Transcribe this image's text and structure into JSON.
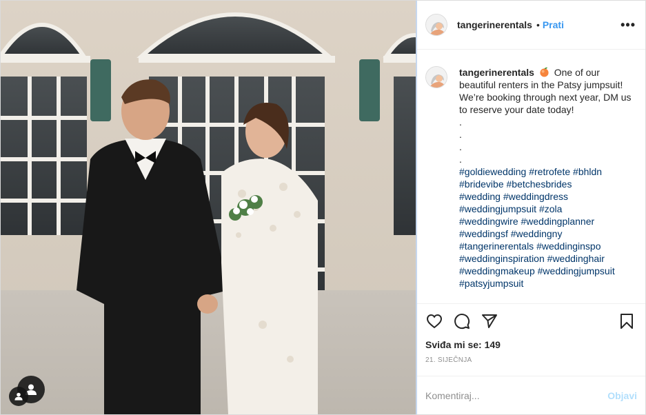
{
  "header": {
    "username": "tangerinerentals",
    "separator": "•",
    "follow_label": "Prati",
    "more_label": "•••"
  },
  "caption": {
    "username": "tangerinerentals",
    "emoji": "peach-emoji",
    "text": "One of our beautiful renters in the Patsy jumpsuit! We’re booking through next year, DM us to reserve your date today!",
    "dots": [
      ".",
      ".",
      ".",
      "."
    ],
    "hashtags": [
      "#goldiewedding",
      "#retrofete",
      "#bhldn",
      "#bridevibe",
      "#betchesbrides",
      "#wedding",
      "#weddingdress",
      "#weddingjumpsuit",
      "#zola",
      "#weddingwire",
      "#weddingplanner",
      "#weddingsf",
      "#weddingny",
      "#tangerinerentals",
      "#weddinginspo",
      "#weddinginspiration",
      "#weddinghair",
      "#weddingmakeup",
      "#weddingjumpsuit",
      "#patsyjumpsuit"
    ]
  },
  "actions": {
    "icons": [
      "heart-icon",
      "comment-icon",
      "share-icon",
      "bookmark-icon"
    ]
  },
  "likes": "Sviđa mi se: 149",
  "date": "21. SIJEČNJA",
  "comment": {
    "placeholder": "Komentiraj...",
    "post_label": "Objavi"
  },
  "colors": {
    "link_blue": "#3897f0",
    "hashtag_blue": "#003569",
    "post_button_disabled": "#b2dffc",
    "muted": "#8e8e8e"
  }
}
